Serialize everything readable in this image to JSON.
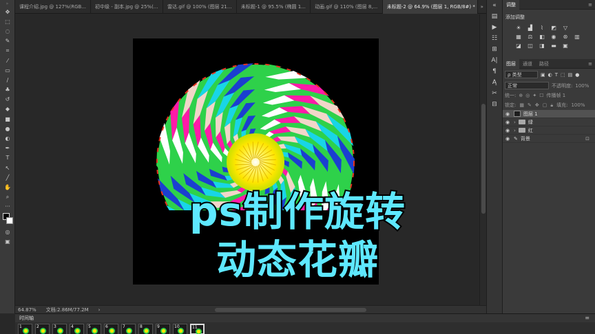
{
  "tabs": [
    {
      "label": "课程介绍.jpg @ 127%(RGB...",
      "active": false
    },
    {
      "label": "初中级 - 副本.jpg @ 25%(...",
      "active": false
    },
    {
      "label": "雷达.gif @ 100% (图层 21...",
      "active": false
    },
    {
      "label": "未标题-1 @ 95.5% (椭圆 1...",
      "active": false
    },
    {
      "label": "动画.gif @ 110% (图层 8,...",
      "active": false
    },
    {
      "label": "未标题-2 @ 64.9% (图层 1, RGB/8#) *",
      "active": true
    }
  ],
  "overlay": {
    "line1": "ps制作旋转",
    "line2": "动态花瓣"
  },
  "status": {
    "zoom": "64.87%",
    "doc": "文档:2.86M/77.2M"
  },
  "timeline": {
    "title": "时间轴",
    "frames": [
      "1",
      "2",
      "3",
      "4",
      "5",
      "6",
      "7",
      "8",
      "9",
      "10",
      "11"
    ],
    "selected": 10
  },
  "adjustments": {
    "tab": "调整",
    "title": "添加调整"
  },
  "layers_panel": {
    "tabs": [
      "图层",
      "通道",
      "路径"
    ],
    "filter_label": "ρ 类型",
    "blend_mode": "正常",
    "opacity_label": "不透明度:",
    "opacity": "100%",
    "unify_label": "统一:",
    "propagate_label": "传播帧 1",
    "lock_label": "锁定:",
    "fill_label": "填充:",
    "fill": "100%",
    "layers": [
      {
        "name": "图层 1",
        "type": "layer",
        "selected": true
      },
      {
        "name": "绿",
        "type": "group",
        "selected": false
      },
      {
        "name": "红",
        "type": "group",
        "selected": false
      },
      {
        "name": "背景",
        "type": "background",
        "selected": false
      }
    ]
  },
  "colors": {
    "accent": "#5ee8ff",
    "green": "#2ed14a",
    "yellow": "#ffe600",
    "magenta": "#ff1aa8",
    "cyan": "#19d5e6"
  }
}
